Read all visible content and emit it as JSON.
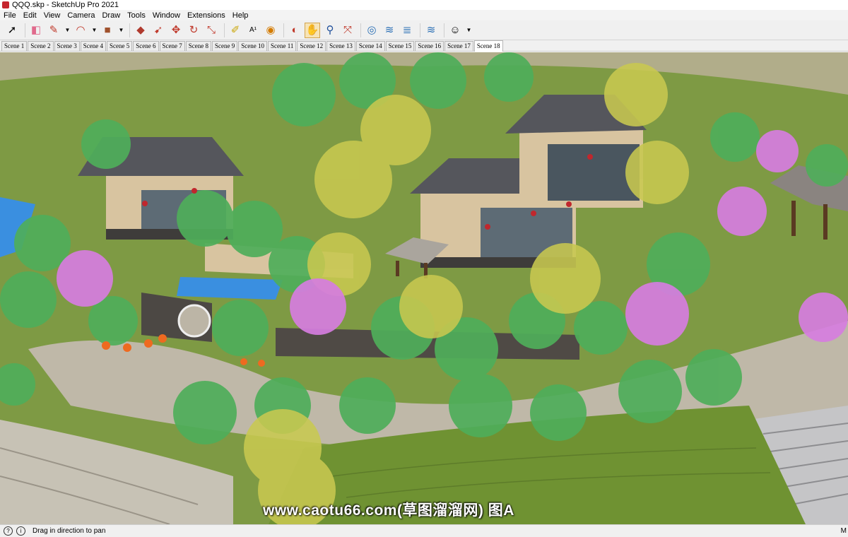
{
  "window": {
    "title": "QQQ.skp - SketchUp Pro 2021"
  },
  "menu": [
    "File",
    "Edit",
    "View",
    "Camera",
    "Draw",
    "Tools",
    "Window",
    "Extensions",
    "Help"
  ],
  "toolbar": {
    "icons": [
      "select-arrow",
      "eraser",
      "pencil-line",
      "arc",
      "rectangle-shape",
      "push-pull",
      "follow-me",
      "move",
      "rotate",
      "scale",
      "tape-measure",
      "text-label",
      "paint-bucket",
      "orbit",
      "pan-hand",
      "zoom",
      "zoom-extents",
      "position-camera",
      "sandbox-from-contours",
      "sandbox-smoove",
      "sandbox-drape",
      "profile"
    ],
    "active": "pan-hand"
  },
  "scenes": {
    "tabs": [
      "Scene 1",
      "Scene 2",
      "Scene 3",
      "Scene 4",
      "Scene 5",
      "Scene 6",
      "Scene 7",
      "Scene 8",
      "Scene 9",
      "Scene 10",
      "Scene 11",
      "Scene 12",
      "Scene 13",
      "Scene 14",
      "Scene 15",
      "Scene 16",
      "Scene 17",
      "Scene 18"
    ],
    "active": "Scene 18"
  },
  "viewport": {
    "watermark": "www.caotu66.com(草图溜溜网) 图A"
  },
  "status": {
    "hint": "Drag in direction to pan",
    "info_icon": "i",
    "right_text": "M"
  },
  "colors": {
    "grass": "#7a9a3c",
    "pavement": "#bfb8a8",
    "roof": "#55565c",
    "wall": "#d8c4a0",
    "water": "#3a8fe0",
    "tree_green": "#4fae5a",
    "tree_yellow": "#c8c850",
    "tree_pink": "#d67de0"
  }
}
